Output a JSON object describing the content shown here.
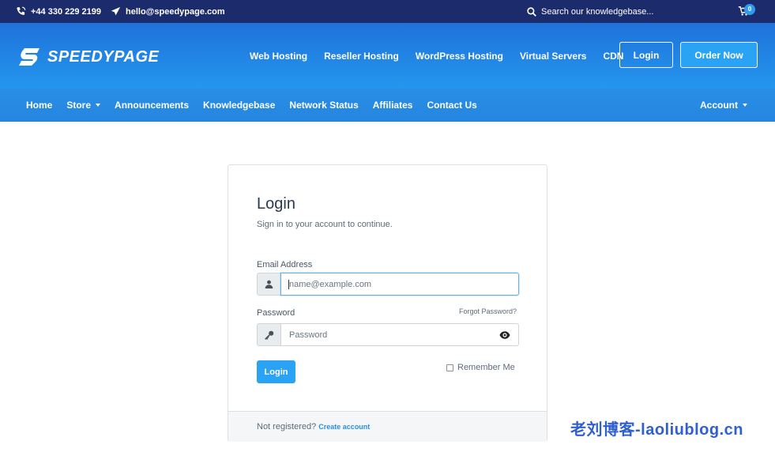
{
  "topbar": {
    "phone": "+44 330 229 2199",
    "email": "hello@speedypage.com",
    "search_placeholder": "Search our knowledgebase...",
    "cart_count": "0"
  },
  "header": {
    "logo_text": "SPEEDYPAGE",
    "nav": [
      "Web Hosting",
      "Reseller Hosting",
      "WordPress Hosting",
      "Virtual Servers",
      "CDN"
    ],
    "login_label": "Login",
    "order_label": "Order Now"
  },
  "subnav": {
    "home": "Home",
    "store": "Store",
    "announcements": "Announcements",
    "knowledgebase": "Knowledgebase",
    "network_status": "Network Status",
    "affiliates": "Affiliates",
    "contact": "Contact Us",
    "account": "Account"
  },
  "login": {
    "title": "Login",
    "subtitle": "Sign in to your account to continue.",
    "email_label": "Email Address",
    "email_placeholder": "name@example.com",
    "password_label": "Password",
    "forgot": "Forgot Password?",
    "password_placeholder": "Password",
    "submit": "Login",
    "remember": "Remember Me",
    "not_registered": "Not registered?",
    "create_account": "Create account"
  },
  "watermark": "老刘博客-laoliublog.cn",
  "colors": {
    "topbar": "#1c2b6b",
    "header": "#2496ee",
    "accent": "#2aa3f5",
    "link": "#2a8fe0"
  }
}
